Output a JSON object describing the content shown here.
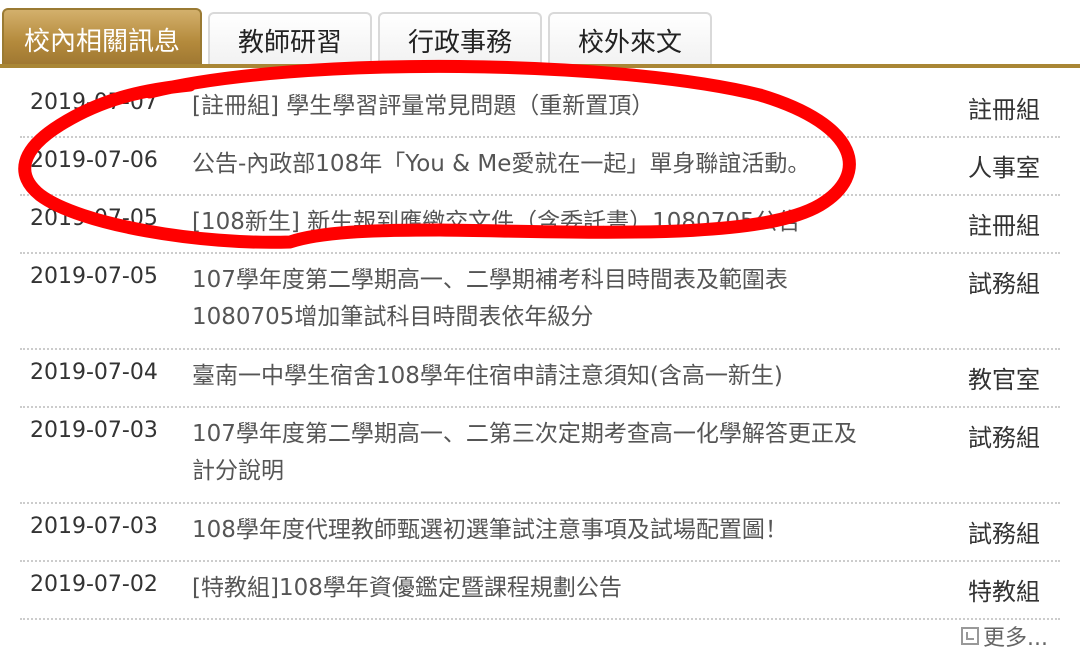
{
  "tabs": [
    {
      "label": "校內相關訊息",
      "active": true
    },
    {
      "label": "教師研習",
      "active": false
    },
    {
      "label": "行政事務",
      "active": false
    },
    {
      "label": "校外來文",
      "active": false
    }
  ],
  "rows": [
    {
      "date": "2019-07-07",
      "title": "[註冊組] 學生學習評量常見問題（重新置頂）",
      "unit": "註冊組"
    },
    {
      "date": "2019-07-06",
      "title": "公告-內政部108年「You & Me愛就在一起」單身聯誼活動。",
      "unit": "人事室"
    },
    {
      "date": "2019-07-05",
      "title": "[108新生] 新生報到應繳交文件（含委託書）1080705公告",
      "unit": "註冊組"
    },
    {
      "date": "2019-07-05",
      "title": "107學年度第二學期高一、二學期補考科目時間表及範圍表1080705增加筆試科目時間表依年級分",
      "unit": "試務組"
    },
    {
      "date": "2019-07-04",
      "title": "臺南一中學生宿舍108學年住宿申請注意須知(含高一新生)",
      "unit": "教官室"
    },
    {
      "date": "2019-07-03",
      "title": "107學年度第二學期高一、二第三次定期考查高一化學解答更正及計分說明",
      "unit": "試務組"
    },
    {
      "date": "2019-07-03",
      "title": "108學年度代理教師甄選初選筆試注意事項及試場配置圖！",
      "unit": "試務組"
    },
    {
      "date": "2019-07-02",
      "title": "[特教組]108學年資優鑑定暨課程規劃公告",
      "unit": "特教組"
    }
  ],
  "more_label": "更多...",
  "colors": {
    "active_tab": "#b48a3c",
    "annotation": "#ff0000"
  }
}
